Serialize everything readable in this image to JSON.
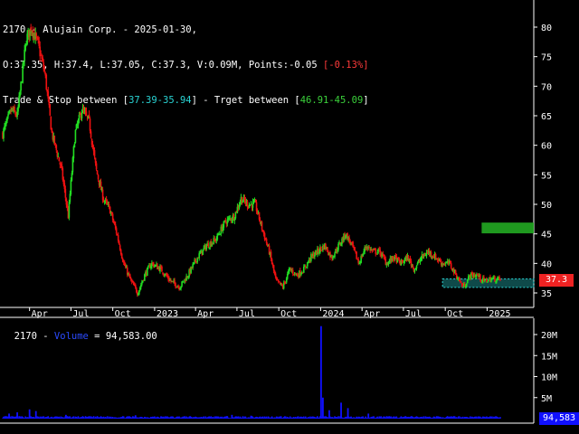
{
  "header": {
    "line1": "2170 - Alujain Corp. - 2025-01-30,",
    "line2_main": "O:37.35, H:37.4, L:37.05, C:37.3, V:0.09M, Points:-0.05 ",
    "line2_pct": "[-0.13%]",
    "line3_a": "Trade & Stop between [",
    "line3_stop": "37.39-35.94",
    "line3_b": "] - Trget between [",
    "line3_target": "46.91-45.09",
    "line3_c": "]"
  },
  "volume_header": {
    "ticker": "2170",
    "sep": " - ",
    "label": "Volume",
    "value": " = 94,583.00"
  },
  "price_tag": "37.3",
  "volume_tag": "94,583",
  "colors": {
    "up": "#22dd22",
    "down": "#ee1111",
    "stop_zone": "#2ad4d4",
    "target_zone": "#22aa22",
    "volume": "#1010ff",
    "axis": "#ffffff",
    "price_tag_bg": "#ee2222",
    "volume_tag_bg": "#1010ff"
  },
  "chart_data": {
    "type": "candlestick",
    "symbol": "2170",
    "x_tick_labels": [
      "Apr",
      "Jul",
      "Oct",
      "2023",
      "Apr",
      "Jul",
      "Oct",
      "2024",
      "Apr",
      "Jul",
      "Oct",
      "2025"
    ],
    "y_tick_labels": [
      "35",
      "40",
      "45",
      "50",
      "55",
      "60",
      "65",
      "70",
      "75",
      "80"
    ],
    "ylim": [
      33,
      82
    ],
    "volume_tick_labels": [
      "5M",
      "10M",
      "15M",
      "20M"
    ],
    "volume_ylim": [
      0,
      23000000
    ],
    "close_path": [
      {
        "date": "2022-02-01",
        "close": 62
      },
      {
        "date": "2022-02-20",
        "close": 66
      },
      {
        "date": "2022-03-05",
        "close": 65
      },
      {
        "date": "2022-03-25",
        "close": 78
      },
      {
        "date": "2022-04-05",
        "close": 80
      },
      {
        "date": "2022-04-20",
        "close": 77
      },
      {
        "date": "2022-05-05",
        "close": 72
      },
      {
        "date": "2022-05-20",
        "close": 62
      },
      {
        "date": "2022-06-10",
        "close": 56
      },
      {
        "date": "2022-06-25",
        "close": 48
      },
      {
        "date": "2022-07-10",
        "close": 62
      },
      {
        "date": "2022-07-25",
        "close": 66
      },
      {
        "date": "2022-08-10",
        "close": 64
      },
      {
        "date": "2022-08-25",
        "close": 56
      },
      {
        "date": "2022-09-10",
        "close": 51
      },
      {
        "date": "2022-09-25",
        "close": 49
      },
      {
        "date": "2022-10-10",
        "close": 45
      },
      {
        "date": "2022-10-25",
        "close": 40
      },
      {
        "date": "2022-11-10",
        "close": 37
      },
      {
        "date": "2022-11-25",
        "close": 35
      },
      {
        "date": "2022-12-10",
        "close": 38
      },
      {
        "date": "2022-12-25",
        "close": 40
      },
      {
        "date": "2023-01-15",
        "close": 39
      },
      {
        "date": "2023-02-05",
        "close": 37
      },
      {
        "date": "2023-02-25",
        "close": 36
      },
      {
        "date": "2023-03-15",
        "close": 38
      },
      {
        "date": "2023-04-05",
        "close": 41
      },
      {
        "date": "2023-04-25",
        "close": 43
      },
      {
        "date": "2023-05-15",
        "close": 44
      },
      {
        "date": "2023-06-05",
        "close": 47
      },
      {
        "date": "2023-06-25",
        "close": 48
      },
      {
        "date": "2023-07-10",
        "close": 51
      },
      {
        "date": "2023-07-25",
        "close": 50
      },
      {
        "date": "2023-08-10",
        "close": 50
      },
      {
        "date": "2023-08-25",
        "close": 46
      },
      {
        "date": "2023-09-10",
        "close": 42
      },
      {
        "date": "2023-09-25",
        "close": 37
      },
      {
        "date": "2023-10-10",
        "close": 36
      },
      {
        "date": "2023-10-25",
        "close": 39
      },
      {
        "date": "2023-11-10",
        "close": 38
      },
      {
        "date": "2023-11-25",
        "close": 39
      },
      {
        "date": "2023-12-10",
        "close": 41
      },
      {
        "date": "2023-12-25",
        "close": 42
      },
      {
        "date": "2024-01-10",
        "close": 43
      },
      {
        "date": "2024-01-25",
        "close": 41
      },
      {
        "date": "2024-02-10",
        "close": 43
      },
      {
        "date": "2024-02-25",
        "close": 45
      },
      {
        "date": "2024-03-10",
        "close": 43
      },
      {
        "date": "2024-03-25",
        "close": 40
      },
      {
        "date": "2024-04-10",
        "close": 43
      },
      {
        "date": "2024-04-25",
        "close": 42
      },
      {
        "date": "2024-05-10",
        "close": 42
      },
      {
        "date": "2024-05-25",
        "close": 40
      },
      {
        "date": "2024-06-10",
        "close": 41
      },
      {
        "date": "2024-06-25",
        "close": 40
      },
      {
        "date": "2024-07-10",
        "close": 41
      },
      {
        "date": "2024-07-25",
        "close": 39
      },
      {
        "date": "2024-08-10",
        "close": 41
      },
      {
        "date": "2024-08-25",
        "close": 42
      },
      {
        "date": "2024-09-10",
        "close": 41
      },
      {
        "date": "2024-09-25",
        "close": 40
      },
      {
        "date": "2024-10-10",
        "close": 40
      },
      {
        "date": "2024-10-25",
        "close": 38
      },
      {
        "date": "2024-11-10",
        "close": 36
      },
      {
        "date": "2024-11-25",
        "close": 38
      },
      {
        "date": "2024-12-10",
        "close": 38
      },
      {
        "date": "2024-12-25",
        "close": 37
      },
      {
        "date": "2025-01-10",
        "close": 37.4
      },
      {
        "date": "2025-01-30",
        "close": 37.3
      }
    ],
    "last_candle": {
      "date": "2025-01-30",
      "open": 37.35,
      "high": 37.4,
      "low": 37.05,
      "close": 37.3,
      "volume": 94583
    },
    "trade_stop_zone": [
      35.94,
      37.39
    ],
    "target_zone": [
      45.09,
      46.91
    ],
    "volume_spikes": [
      {
        "date": "2022-02-15",
        "volume": 1200000
      },
      {
        "date": "2022-03-05",
        "volume": 1500000
      },
      {
        "date": "2022-04-01",
        "volume": 2200000
      },
      {
        "date": "2022-04-15",
        "volume": 1800000
      },
      {
        "date": "2022-06-20",
        "volume": 900000
      },
      {
        "date": "2022-11-20",
        "volume": 800000
      },
      {
        "date": "2023-06-20",
        "volume": 900000
      },
      {
        "date": "2023-08-01",
        "volume": 700000
      },
      {
        "date": "2024-01-02",
        "volume": 22000000
      },
      {
        "date": "2024-01-06",
        "volume": 5000000
      },
      {
        "date": "2024-01-20",
        "volume": 2000000
      },
      {
        "date": "2024-02-15",
        "volume": 3800000
      },
      {
        "date": "2024-03-01",
        "volume": 2500000
      },
      {
        "date": "2024-04-15",
        "volume": 1200000
      }
    ]
  }
}
